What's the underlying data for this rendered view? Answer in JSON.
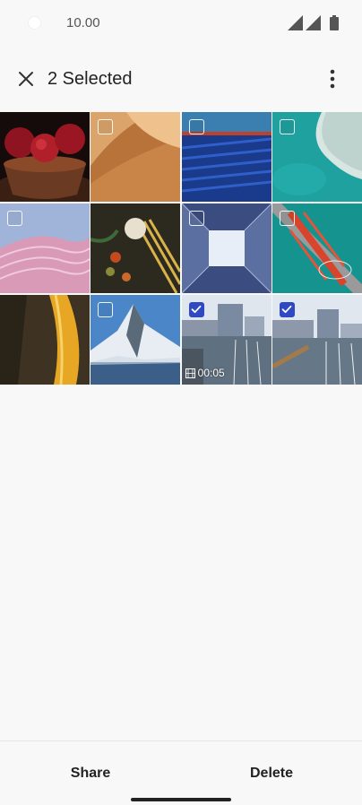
{
  "status_bar": {
    "time": "10.00",
    "icons": [
      "camera-cutout-icon",
      "signal-icon",
      "signal-icon",
      "battery-icon"
    ]
  },
  "app_bar": {
    "title": "2 Selected",
    "close_icon": "close-icon",
    "more_icon": "more-vertical-icon"
  },
  "grid": {
    "items": [
      {
        "subject": "pomegranates",
        "selected": false,
        "show_checkbox": false
      },
      {
        "subject": "desert-dunes",
        "selected": false,
        "show_checkbox": true
      },
      {
        "subject": "blue-abstract",
        "selected": false,
        "show_checkbox": true
      },
      {
        "subject": "teal-coast",
        "selected": false,
        "show_checkbox": true
      },
      {
        "subject": "pink-waves",
        "selected": false,
        "show_checkbox": true
      },
      {
        "subject": "garlic-still-life",
        "selected": false,
        "show_checkbox": false
      },
      {
        "subject": "building-skylight",
        "selected": false,
        "show_checkbox": true
      },
      {
        "subject": "red-bridge",
        "selected": false,
        "show_checkbox": true
      },
      {
        "subject": "golden-waterfall",
        "selected": false,
        "show_checkbox": false
      },
      {
        "subject": "matterhorn",
        "selected": false,
        "show_checkbox": true
      },
      {
        "subject": "harbor-video",
        "selected": true,
        "show_checkbox": true,
        "duration": "00:05"
      },
      {
        "subject": "harbor-photo",
        "selected": true,
        "show_checkbox": true
      }
    ]
  },
  "bottom_bar": {
    "share_label": "Share",
    "delete_label": "Delete"
  },
  "colors": {
    "accent": "#2e49c1",
    "background": "#f8f8f8",
    "text": "#222222"
  }
}
